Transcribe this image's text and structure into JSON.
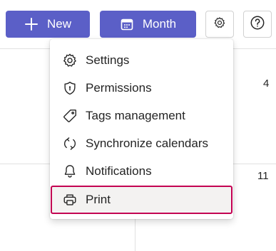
{
  "toolbar": {
    "new_label": "New",
    "new_icon": "plus-icon",
    "view_label": "Month",
    "view_icon": "calendar-icon",
    "settings_icon": "gear-icon",
    "help_icon": "question-icon",
    "accent_color": "#5b5fc7"
  },
  "calendar": {
    "day_numbers": [
      "4",
      "11"
    ]
  },
  "menu": {
    "items": [
      {
        "label": "Settings",
        "icon": "gear-icon"
      },
      {
        "label": "Permissions",
        "icon": "shield-icon"
      },
      {
        "label": "Tags management",
        "icon": "tag-icon"
      },
      {
        "label": "Synchronize calendars",
        "icon": "sync-icon"
      },
      {
        "label": "Notifications",
        "icon": "bell-icon"
      },
      {
        "label": "Print",
        "icon": "printer-icon",
        "selected": true
      }
    ],
    "selected_outline_color": "#c30052"
  }
}
